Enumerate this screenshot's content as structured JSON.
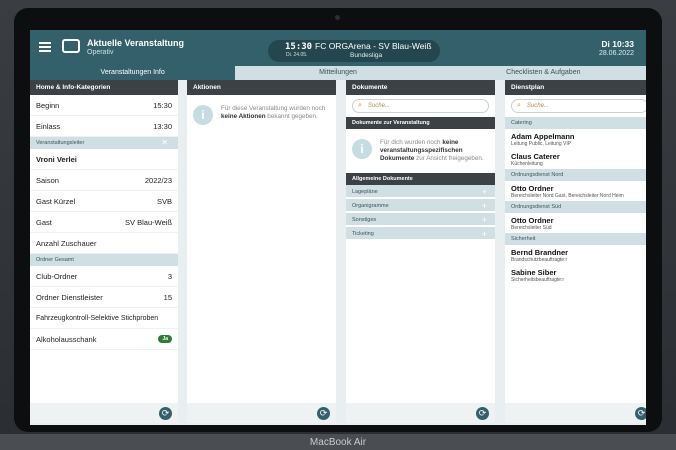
{
  "app": {
    "title": "Aktuelle Veranstaltung",
    "subtitle": "Operativ",
    "time": "15:30",
    "time_sub": "Di. 24.05.",
    "match": "FC ORGArena - SV Blau-Weiß",
    "league": "Bundesliga",
    "date": "Di 10:33",
    "date_sub": "28.06.2022"
  },
  "tabs": [
    "Veranstaltungen Info",
    "Mitteilungen",
    "Checklisten & Aufgaben"
  ],
  "panel1": {
    "header": "Home & Info-Kategorien",
    "beginn": {
      "label": "Beginn",
      "value": "15:30"
    },
    "einlass": {
      "label": "Einlass",
      "value": "13:30"
    },
    "section_leiter": "Veranstaltungsleiter",
    "close_glyph": "✕",
    "leiter_name": "Vroni Verlei",
    "saison": {
      "label": "Saison",
      "value": "2022/23"
    },
    "kuerzel": {
      "label": "Gast Kürzel",
      "value": "SVB"
    },
    "gast": {
      "label": "Gast",
      "value": "SV Blau-Weiß"
    },
    "zuschauer": {
      "label": "Anzahl Zuschauer",
      "value": ""
    },
    "section_ordner": "Ordner Gesamt",
    "club_ordner": {
      "label": "Club-Ordner",
      "value": "3"
    },
    "dienstleister": {
      "label": "Ordner Dienstleister",
      "value": "15"
    },
    "fahrzeug": {
      "label": "Fahrzeugkontroll-Selektive Stichproben",
      "value": ""
    },
    "alkohol": {
      "label": "Alkoholausschank",
      "value": "Ja"
    }
  },
  "panel2": {
    "header": "Aktionen",
    "info_pre": "Für diese Veranstaltung wurden noch ",
    "info_bold": "keine Aktionen",
    "info_post": " bekannt gegeben."
  },
  "panel3": {
    "header": "Dokumente",
    "search_placeholder": "Suche...",
    "event_docs_header": "Dokumente zur Veranstaltung",
    "info_pre": "Für dich wurden noch ",
    "info_bold": "keine veranstaltungsspezifischen Dokumente",
    "info_post": " zur Ansicht freigegeben.",
    "general_header": "Allgemeine Dokumente",
    "items": [
      "Lagepläne",
      "Organigramme",
      "Sonstiges",
      "Ticketing"
    ]
  },
  "panel4": {
    "header": "Dienstplan",
    "search_placeholder": "Suche...",
    "groups": [
      {
        "label": "Catering",
        "people": [
          {
            "name": "Adam Appelmann",
            "role": "Leitung Public, Leitung VIP"
          },
          {
            "name": "Claus Caterer",
            "role": "Küchenleitung"
          }
        ]
      },
      {
        "label": "Ordnungsdienst Nord",
        "people": [
          {
            "name": "Otto Ordner",
            "role": "Bereichsleiter Nord Gast, Bereichsleiter Nord Heim"
          }
        ]
      },
      {
        "label": "Ordnungsdienst Süd",
        "people": [
          {
            "name": "Otto Ordner",
            "role": "Bereichsleiter Süd"
          }
        ]
      },
      {
        "label": "Sicherheit",
        "people": [
          {
            "name": "Bernd Brandner",
            "role": "Brandschutzbeauftragte:r"
          },
          {
            "name": "Sabine Siber",
            "role": "Sicherheitsbeauftragte:r"
          }
        ]
      }
    ]
  },
  "device_label": "MacBook Air",
  "colors": {
    "primary": "#33606b",
    "section": "#cfdfe3",
    "header_dark": "#3c4146",
    "badge": "#2e7d32"
  }
}
